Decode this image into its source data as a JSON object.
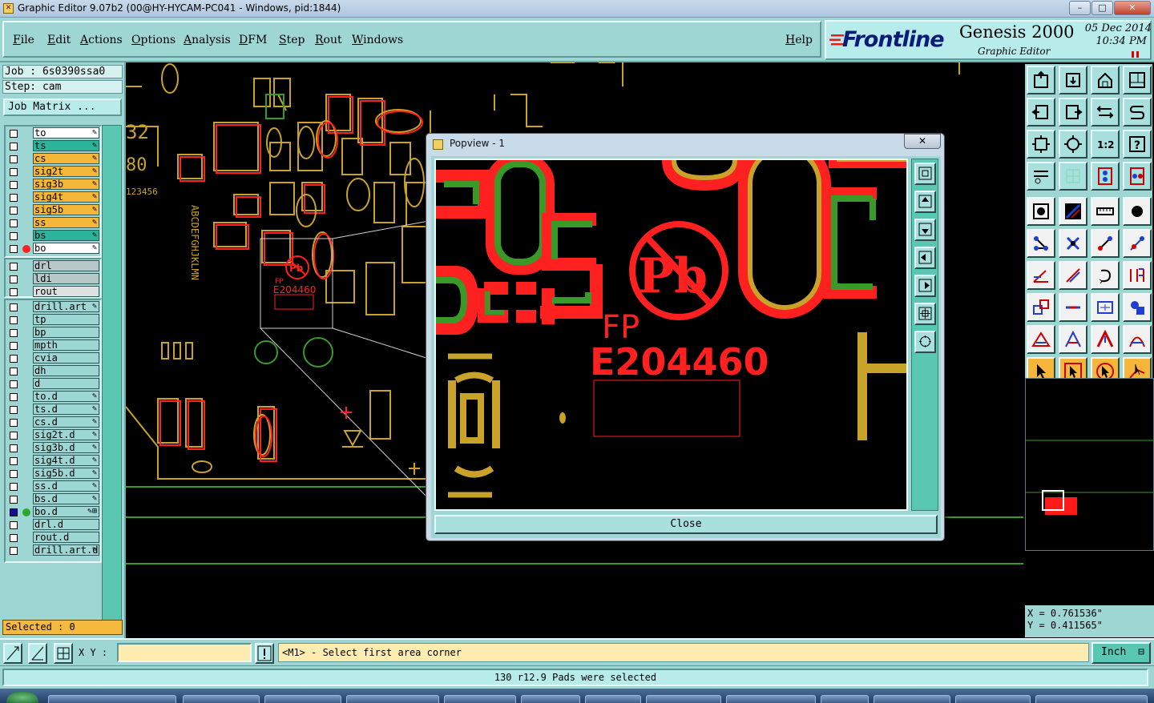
{
  "window": {
    "title": "Graphic Editor 9.07b2 (00@HY-HYCAM-PC041 - Windows, pid:1844)",
    "minimize": "–",
    "maximize": "□",
    "close": "✕"
  },
  "menu": {
    "items": [
      "File",
      "Edit",
      "Actions",
      "Options",
      "Analysis",
      "DFM",
      "Step",
      "Rout",
      "Windows"
    ],
    "help": "Help"
  },
  "brand": {
    "logo": "Frontline",
    "product": "Genesis 2000",
    "subtitle": "Graphic Editor",
    "date": "05 Dec 2014",
    "time": "10:34 PM"
  },
  "job": {
    "job_line": "Job : 6s0390ssa0",
    "step_line": "Step: cam",
    "job_matrix_button": "Job Matrix ..."
  },
  "layers": {
    "group1": [
      {
        "name": "to",
        "color": "#ffffff",
        "tag": "✎",
        "dot": ""
      },
      {
        "name": "ts",
        "color": "#2cb39a",
        "tag": "✎",
        "dot": ""
      },
      {
        "name": "cs",
        "color": "#f5b63a",
        "tag": "✎",
        "dot": ""
      },
      {
        "name": "sig2t",
        "color": "#f5b63a",
        "tag": "✎",
        "dot": ""
      },
      {
        "name": "sig3b",
        "color": "#f5b63a",
        "tag": "✎",
        "dot": ""
      },
      {
        "name": "sig4t",
        "color": "#f5b63a",
        "tag": "✎",
        "dot": ""
      },
      {
        "name": "sig5b",
        "color": "#f5b63a",
        "tag": "✎",
        "dot": ""
      },
      {
        "name": "ss",
        "color": "#f5b63a",
        "tag": "✎",
        "dot": ""
      },
      {
        "name": "bs",
        "color": "#2cb39a",
        "tag": "✎",
        "dot": ""
      },
      {
        "name": "bo",
        "color": "#ffffff",
        "tag": "✎",
        "dot": "#ff2020"
      }
    ],
    "group2": [
      {
        "name": "drl",
        "color": "#b8c8c8",
        "tag": "",
        "dot": ""
      },
      {
        "name": "ldi",
        "color": "#b8c8c8",
        "tag": "",
        "dot": ""
      },
      {
        "name": "rout",
        "color": "#e0e0e0",
        "tag": "",
        "dot": ""
      }
    ],
    "group3": [
      {
        "name": "drill.art",
        "color": "#9ed6d4",
        "tag": "✎",
        "dot": ""
      },
      {
        "name": "tp",
        "color": "#9ed6d4",
        "tag": "",
        "dot": ""
      },
      {
        "name": "bp",
        "color": "#9ed6d4",
        "tag": "",
        "dot": ""
      },
      {
        "name": "mpth",
        "color": "#9ed6d4",
        "tag": "",
        "dot": ""
      },
      {
        "name": "cvia",
        "color": "#9ed6d4",
        "tag": "",
        "dot": ""
      },
      {
        "name": "dh",
        "color": "#9ed6d4",
        "tag": "",
        "dot": ""
      },
      {
        "name": "d",
        "color": "#9ed6d4",
        "tag": "",
        "dot": ""
      },
      {
        "name": "to.d",
        "color": "#9ed6d4",
        "tag": "✎",
        "dot": ""
      },
      {
        "name": "ts.d",
        "color": "#9ed6d4",
        "tag": "✎",
        "dot": ""
      },
      {
        "name": "cs.d",
        "color": "#9ed6d4",
        "tag": "✎",
        "dot": ""
      },
      {
        "name": "sig2t.d",
        "color": "#9ed6d4",
        "tag": "✎",
        "dot": ""
      },
      {
        "name": "sig3b.d",
        "color": "#9ed6d4",
        "tag": "✎",
        "dot": ""
      },
      {
        "name": "sig4t.d",
        "color": "#9ed6d4",
        "tag": "✎",
        "dot": ""
      },
      {
        "name": "sig5b.d",
        "color": "#9ed6d4",
        "tag": "✎",
        "dot": ""
      },
      {
        "name": "ss.d",
        "color": "#9ed6d4",
        "tag": "✎",
        "dot": ""
      },
      {
        "name": "bs.d",
        "color": "#9ed6d4",
        "tag": "✎",
        "dot": ""
      },
      {
        "name": "bo.d",
        "color": "#9ed6d4",
        "tag": "✎⊞",
        "dot": "#2da82d"
      },
      {
        "name": "drl.d",
        "color": "#9ed6d4",
        "tag": "",
        "dot": ""
      },
      {
        "name": "rout.d",
        "color": "#9ed6d4",
        "tag": "",
        "dot": ""
      },
      {
        "name": "drill.art.d",
        "color": "#9ed6d4",
        "tag": "✎",
        "dot": ""
      }
    ]
  },
  "selected_text": "Selected : 0",
  "canvas": {
    "silk_numbers_top": "32",
    "silk_numbers_mid": "80",
    "silk_seq": "123456",
    "silk_letters": "ABCDEFGHJKLMN",
    "label_fp": "FP",
    "label_code": "E204460",
    "label_pb": "Pb"
  },
  "popup": {
    "title": "Popview - 1",
    "close_x": "✕",
    "close_button": "Close",
    "label_pb": "Pb",
    "label_fp": "FP",
    "label_code": "E204460"
  },
  "coords": {
    "x": "X = 0.761536\"",
    "y": "Y = 0.411565\""
  },
  "bottom": {
    "xy_label": "X Y :",
    "xy_value": "",
    "prompt": "<M1> - Select first area corner",
    "unit": "Inch",
    "status": "130 r12.9 Pads were selected"
  },
  "colors": {
    "panel": "#9ed6d4",
    "red_layer": "#ff2020",
    "green_layer": "#3a9a28",
    "gold_layer": "#c9a22a",
    "selected_bg": "#f5b93e"
  }
}
